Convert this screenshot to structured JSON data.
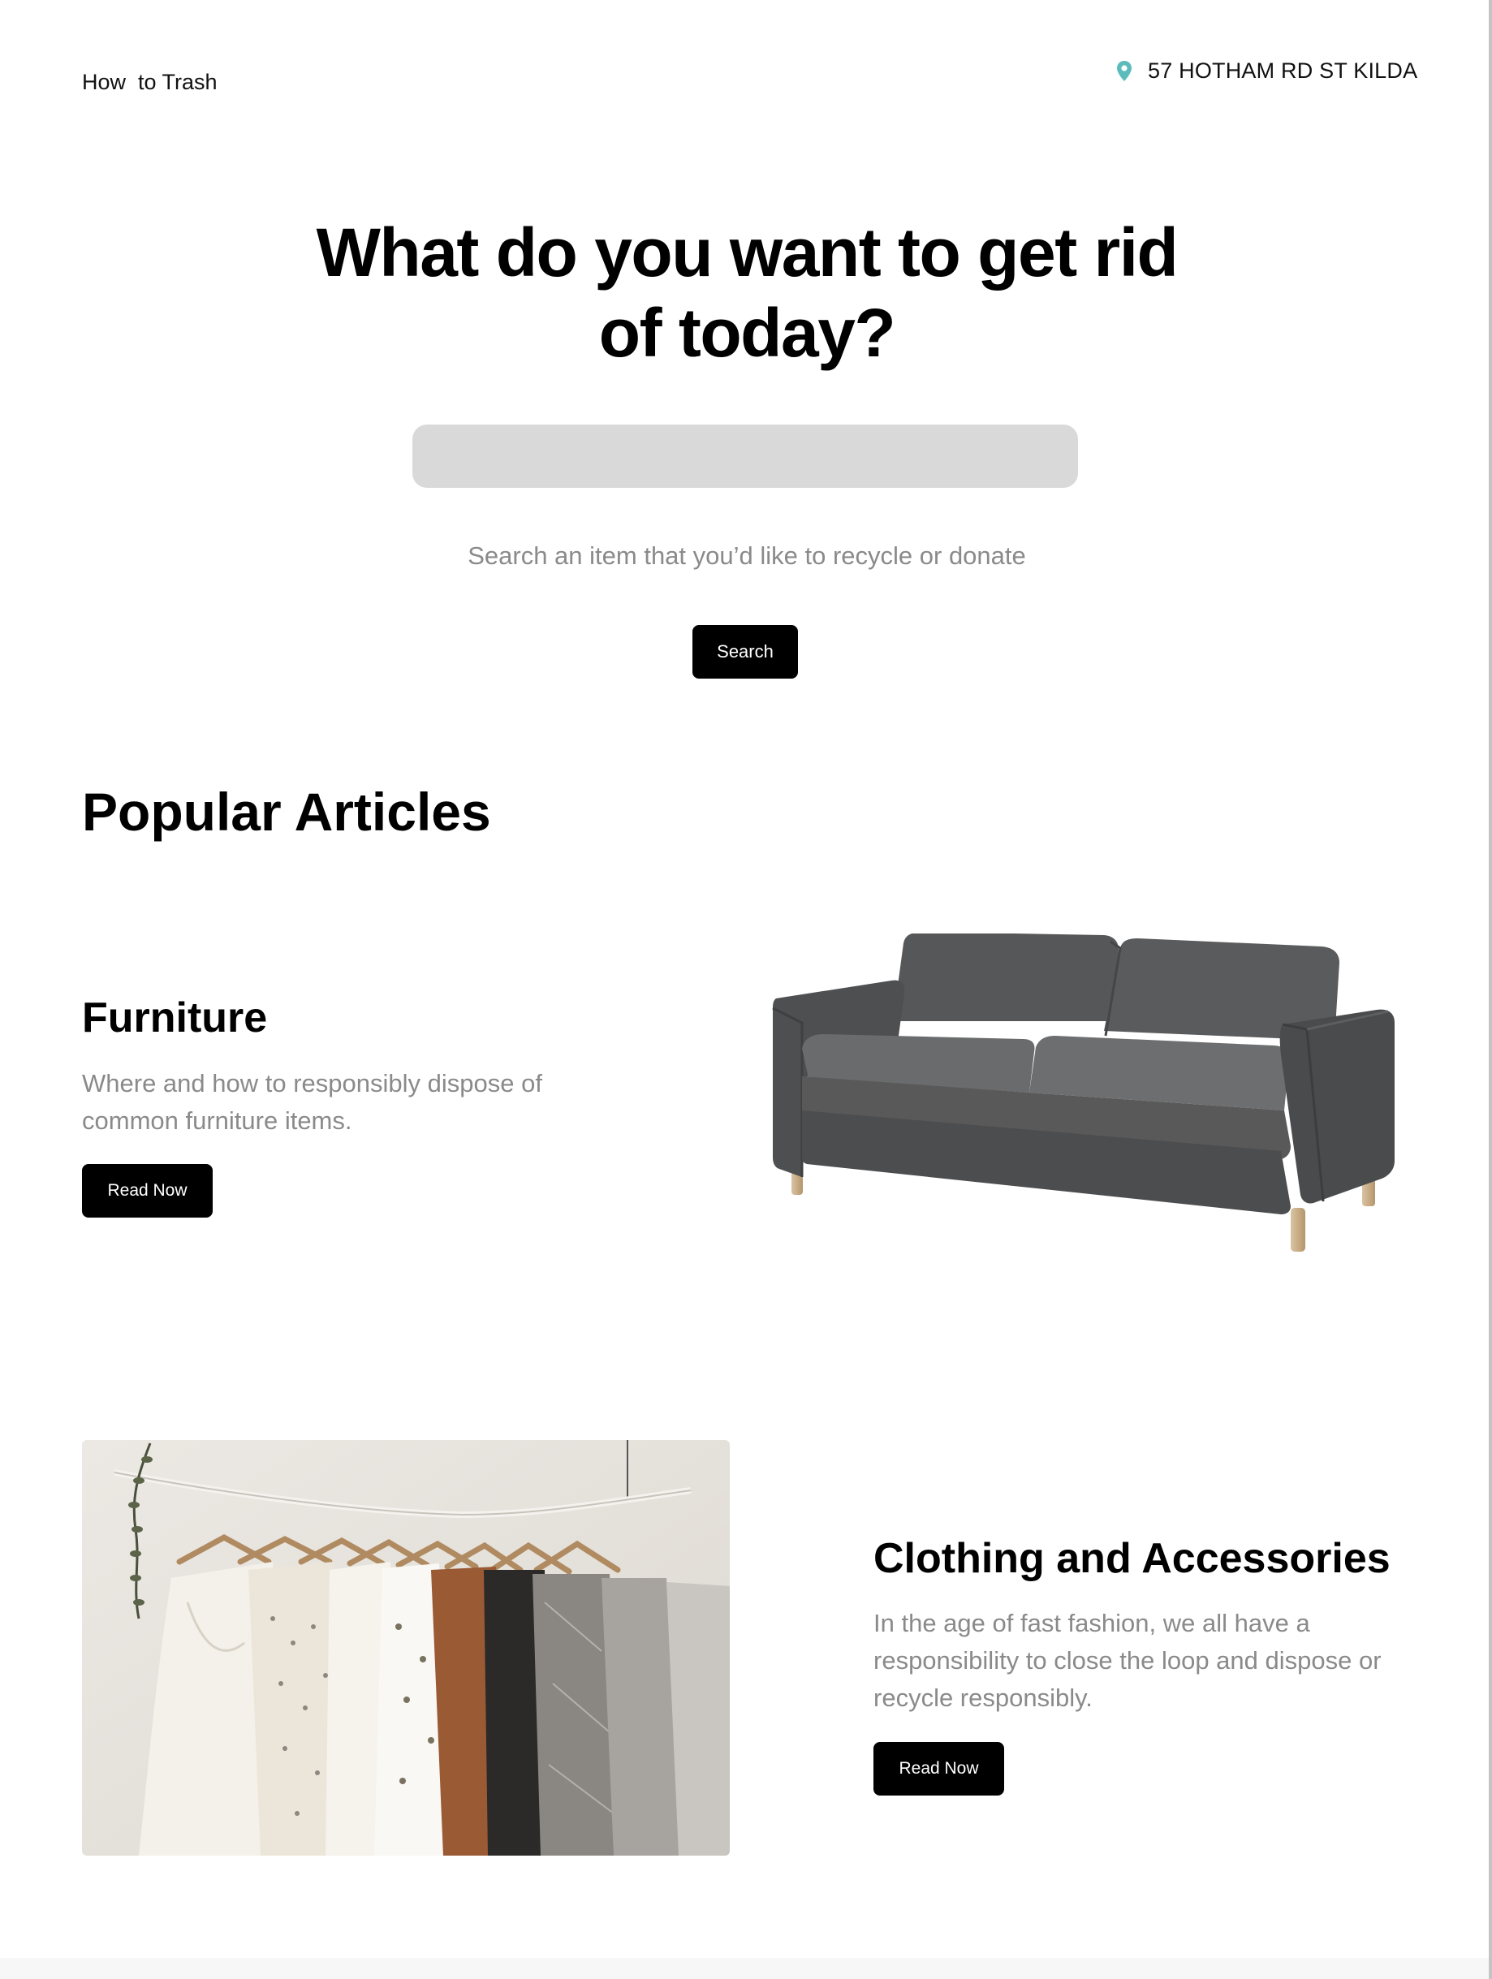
{
  "header": {
    "brand": "How  to Trash",
    "location": "57 HOTHAM RD ST KILDA",
    "location_icon": "location-pin-icon",
    "accent_color": "#5cbcbc"
  },
  "hero": {
    "title_line1": "What do you want to get rid",
    "title_line2": "of today?",
    "search_value": "",
    "search_hint": "Search an item that you’d like to recycle or donate",
    "search_button": "Search"
  },
  "popular": {
    "heading": "Popular Articles",
    "articles": [
      {
        "title": "Furniture",
        "description": "Where and how to responsibly dispose of common furniture items.",
        "button": "Read Now",
        "image": "grey-sofa-image"
      },
      {
        "title": "Clothing and Accessories",
        "description": "In the age of fast fashion, we all have a responsibility to close the loop and dispose or recycle responsibly.",
        "button": "Read Now",
        "image": "clothes-rack-image"
      }
    ]
  }
}
